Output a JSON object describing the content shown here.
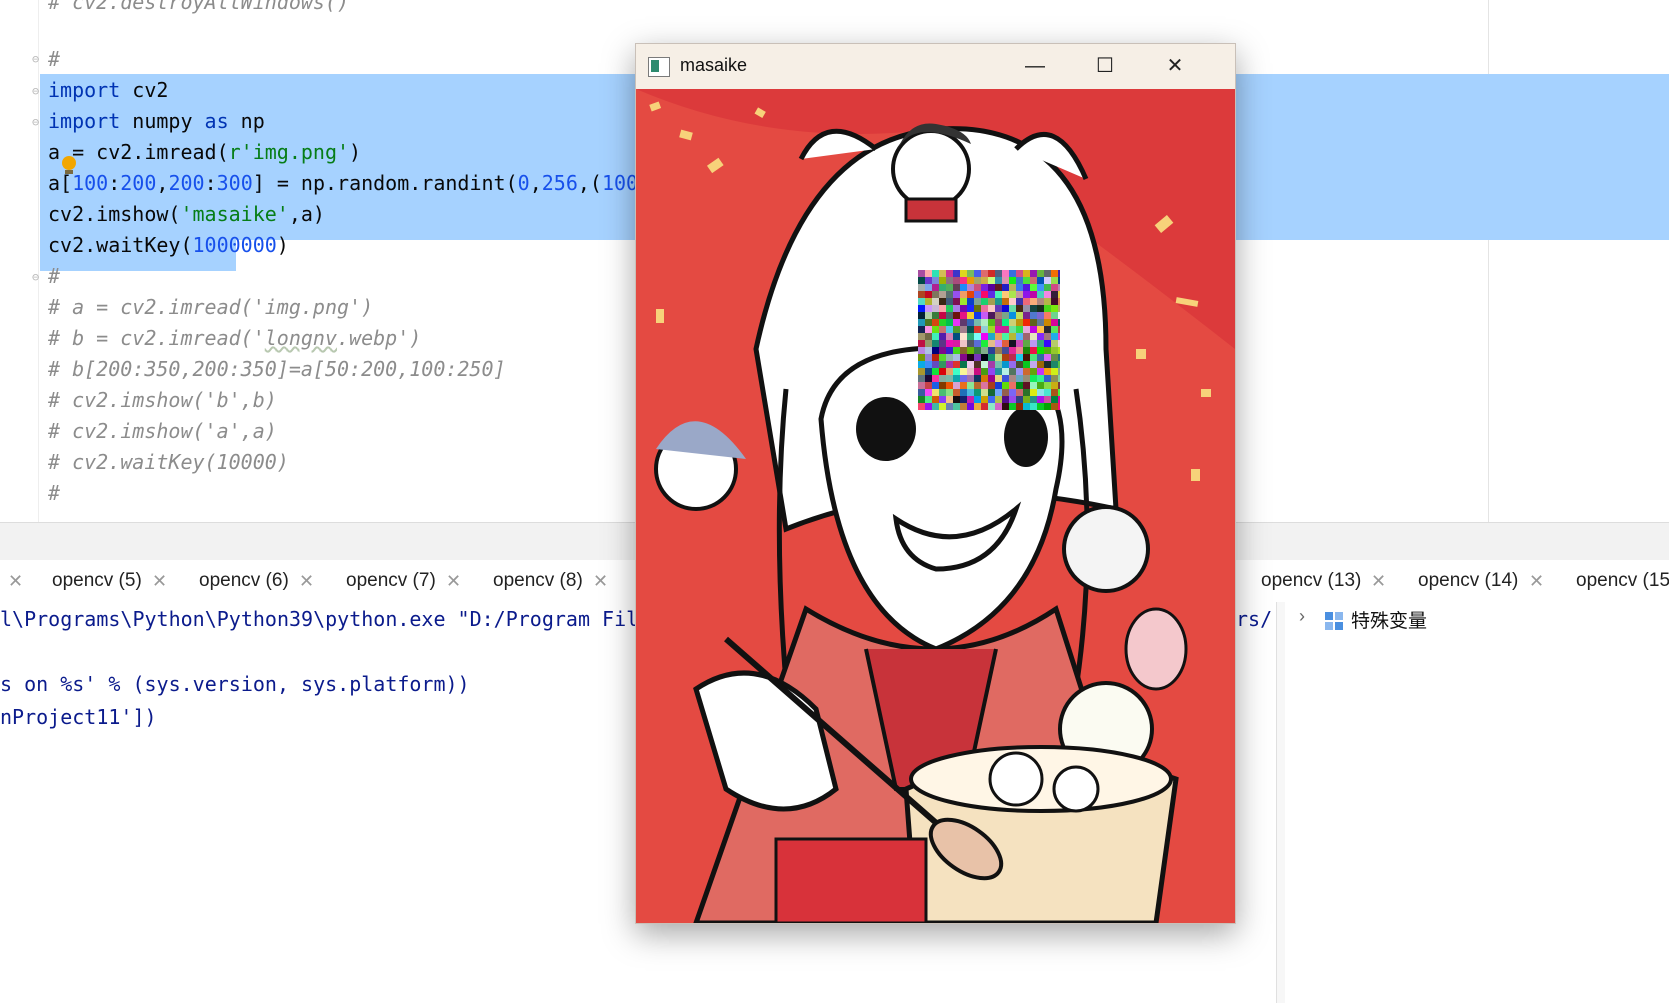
{
  "editor": {
    "top_partial": "# cv2.destroyAllWindows()",
    "lines": [
      {
        "tokens": [
          {
            "t": "#",
            "c": "cm"
          }
        ]
      },
      {
        "tokens": [
          {
            "t": "import",
            "c": "kw"
          },
          {
            "t": " cv2",
            "c": ""
          }
        ]
      },
      {
        "tokens": [
          {
            "t": "import",
            "c": "kw"
          },
          {
            "t": " numpy ",
            "c": ""
          },
          {
            "t": "as",
            "c": "kw"
          },
          {
            "t": " np",
            "c": ""
          }
        ]
      },
      {
        "tokens": [
          {
            "t": "a = cv2.imread(",
            "c": ""
          },
          {
            "t": "r'img.png'",
            "c": "str"
          },
          {
            "t": ")",
            "c": ""
          }
        ]
      },
      {
        "tokens": [
          {
            "t": "a[",
            "c": ""
          },
          {
            "t": "100",
            "c": "num"
          },
          {
            "t": ":",
            "c": ""
          },
          {
            "t": "200",
            "c": "num"
          },
          {
            "t": ",",
            "c": ""
          },
          {
            "t": "200",
            "c": "num"
          },
          {
            "t": ":",
            "c": ""
          },
          {
            "t": "300",
            "c": "num"
          },
          {
            "t": "] = np.random.randint(",
            "c": ""
          },
          {
            "t": "0",
            "c": "num"
          },
          {
            "t": ",",
            "c": ""
          },
          {
            "t": "256",
            "c": "num"
          },
          {
            "t": ",(",
            "c": ""
          },
          {
            "t": "100",
            "c": "num"
          }
        ]
      },
      {
        "tokens": [
          {
            "t": "cv2.imshow(",
            "c": ""
          },
          {
            "t": "'masaike'",
            "c": "str"
          },
          {
            "t": ",a)",
            "c": ""
          }
        ]
      },
      {
        "tokens": [
          {
            "t": "cv2.waitKey(",
            "c": ""
          },
          {
            "t": "1000000",
            "c": "num"
          },
          {
            "t": ")",
            "c": ""
          }
        ]
      },
      {
        "tokens": [
          {
            "t": "#",
            "c": "cm"
          }
        ]
      },
      {
        "tokens": [
          {
            "t": "# a = cv2.imread('img.png')",
            "c": "cm"
          }
        ]
      },
      {
        "tokens": [
          {
            "t": "# b = cv2.imread('",
            "c": "cm"
          },
          {
            "t": "longnv",
            "c": "cm warn-underline"
          },
          {
            "t": ".webp')",
            "c": "cm"
          }
        ]
      },
      {
        "tokens": [
          {
            "t": "# b[200:350,200:350]=a[50:200,100:250]",
            "c": "cm"
          }
        ]
      },
      {
        "tokens": [
          {
            "t": "# cv2.imshow('b',b)",
            "c": "cm"
          }
        ]
      },
      {
        "tokens": [
          {
            "t": "# cv2.imshow('a',a)",
            "c": "cm"
          }
        ]
      },
      {
        "tokens": [
          {
            "t": "# cv2.waitKey(10000)",
            "c": "cm"
          }
        ]
      },
      {
        "tokens": [
          {
            "t": "#",
            "c": "cm"
          }
        ]
      }
    ]
  },
  "run_tabs": [
    {
      "label": "opencv (5)"
    },
    {
      "label": "opencv (6)"
    },
    {
      "label": "opencv (7)"
    },
    {
      "label": "opencv (8)"
    },
    {
      "label": "opencv (13)"
    },
    {
      "label": "opencv (14)"
    },
    {
      "label": "opencv (15"
    }
  ],
  "console": {
    "line1_left": "l\\Programs\\Python\\Python39\\python.exe \"D:/Program Fil",
    "line1_right": "rs/",
    "line2": "s on %s' % (sys.version, sys.platform))",
    "line3": "nProject11'])"
  },
  "variables": {
    "special_vars_label": "特殊变量"
  },
  "image_window": {
    "title": "masaike",
    "minimize_glyph": "—",
    "maximize_glyph": "☐",
    "close_glyph": "✕",
    "image_description": "anime illustration with random-noise mosaic patch"
  },
  "colors": {
    "selection": "#a6d2ff",
    "keyword": "#0033b3",
    "number": "#1750eb",
    "string": "#067d17",
    "comment": "#8c8c8c",
    "console_text": "#0b1b8c",
    "image_background": "#e44a42"
  }
}
